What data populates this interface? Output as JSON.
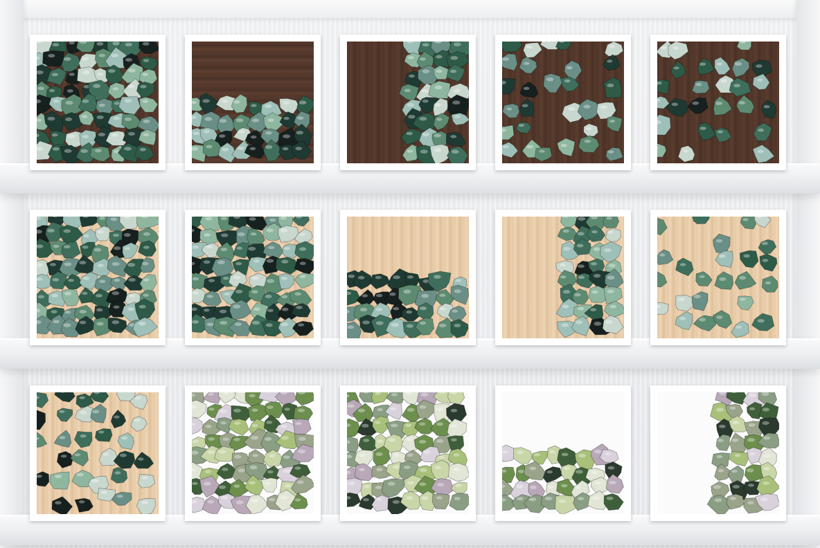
{
  "scene": "shelf-gallery",
  "frames": [
    {
      "id": "row1-1",
      "background": "walnut",
      "arrangement": "scattered"
    },
    {
      "id": "row1-2",
      "background": "walnut",
      "arrangement": "bottom-border"
    },
    {
      "id": "row1-3",
      "background": "walnut",
      "arrangement": "right-border"
    },
    {
      "id": "row1-4",
      "background": "walnut",
      "arrangement": "sparse"
    },
    {
      "id": "row1-5",
      "background": "walnut",
      "arrangement": "sparse"
    },
    {
      "id": "row2-1",
      "background": "beech",
      "arrangement": "scattered"
    },
    {
      "id": "row2-2",
      "background": "beech",
      "arrangement": "scattered"
    },
    {
      "id": "row2-3",
      "background": "beech",
      "arrangement": "bottom-border"
    },
    {
      "id": "row2-4",
      "background": "beech",
      "arrangement": "right-border"
    },
    {
      "id": "row2-5",
      "background": "beech",
      "arrangement": "sparse"
    },
    {
      "id": "row3-1",
      "background": "beech",
      "arrangement": "sparse"
    },
    {
      "id": "row3-2",
      "background": "white",
      "arrangement": "scattered"
    },
    {
      "id": "row3-3",
      "background": "white",
      "arrangement": "scattered"
    },
    {
      "id": "row3-4",
      "background": "white",
      "arrangement": "bottom-border"
    },
    {
      "id": "row3-5",
      "background": "white",
      "arrangement": "right-border"
    }
  ],
  "palettes": {
    "dark_stones": [
      "#1f3a33",
      "#2e5a48",
      "#3f6f5c",
      "#5d8b72",
      "#8fb7a0",
      "#c9d8cf",
      "#16201f",
      "#6a8f86",
      "#9fc0b8"
    ],
    "white_stones": [
      "#3e5f3a",
      "#6c8f4e",
      "#a8c07a",
      "#c9d6a8",
      "#8a9e84",
      "#d9d2dc",
      "#b8a8b8",
      "#2a3a2e",
      "#e1e6d6",
      "#9aa48a"
    ]
  }
}
